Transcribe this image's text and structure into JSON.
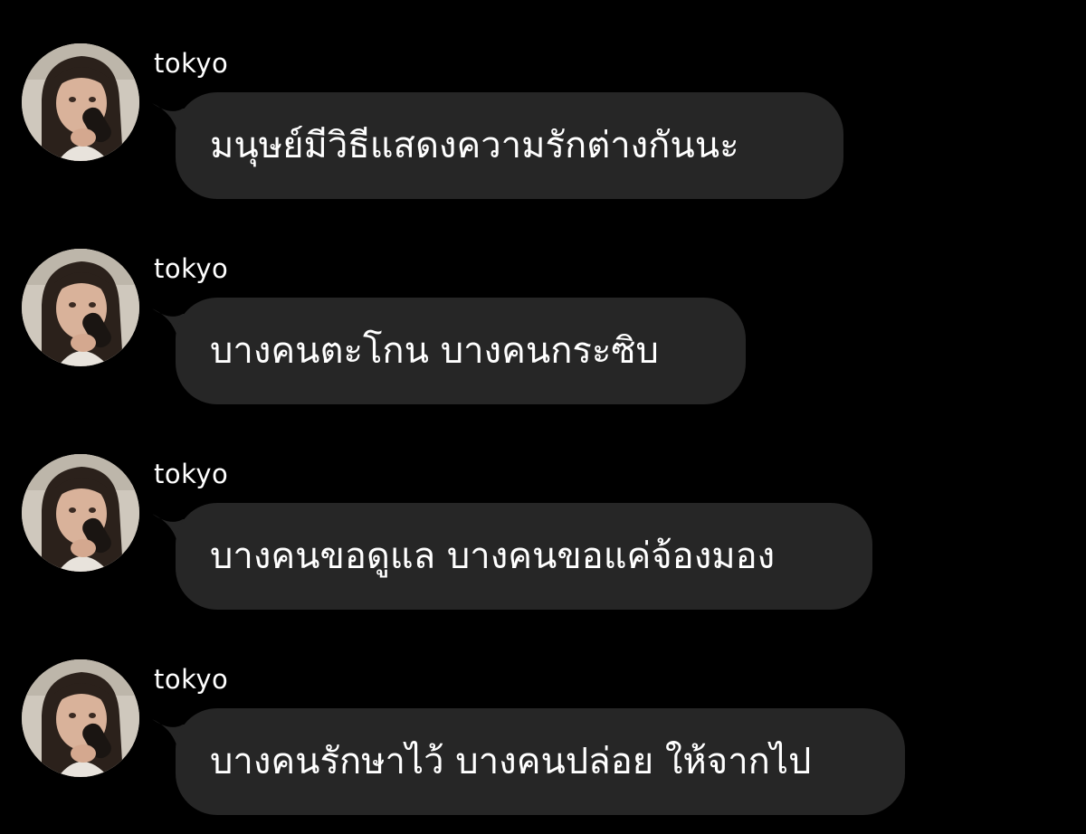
{
  "theme": {
    "background": "#000000",
    "bubble_color": "#262626",
    "text_color": "#ffffff"
  },
  "messages": [
    {
      "sender": "tokyo",
      "avatar_icon": "profile-photo-icon",
      "text": "มนุษย์มีวิธีแสดงความรักต่างกันนะ"
    },
    {
      "sender": "tokyo",
      "avatar_icon": "profile-photo-icon",
      "text": "บางคนตะโกน บางคนกระซิบ"
    },
    {
      "sender": "tokyo",
      "avatar_icon": "profile-photo-icon",
      "text": "บางคนขอดูแล บางคนขอแค่จ้องมอง"
    },
    {
      "sender": "tokyo",
      "avatar_icon": "profile-photo-icon",
      "text": "บางคนรักษาไว้ บางคนปล่อย ให้จากไป"
    }
  ]
}
